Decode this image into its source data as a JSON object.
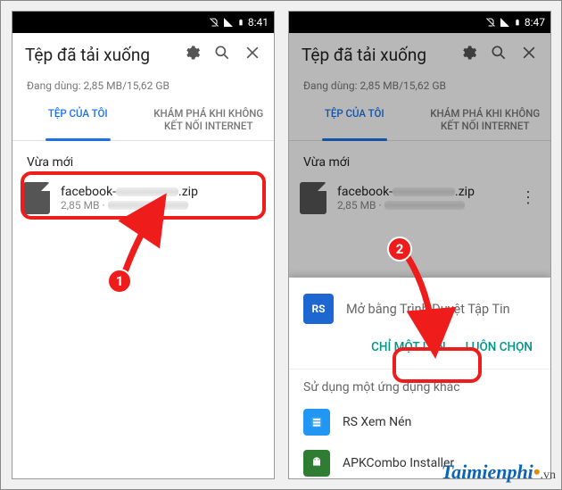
{
  "statusbar": {
    "time_left": "8:41",
    "time_right": "8:47"
  },
  "toolbar": {
    "title": "Tệp đã tải xuống"
  },
  "storage": {
    "line": "Đang dùng: 2,85 MB/15,62 GB"
  },
  "tabs": {
    "mine": "TỆP CỦA TÔI",
    "offline": "KHÁM PHÁ KHI KHÔNG KẾT NỐI INTERNET"
  },
  "section": {
    "recent": "Vừa mới"
  },
  "file": {
    "prefix": "facebook-",
    "suffix": ".zip",
    "size": "2,85 MB"
  },
  "sheet": {
    "open_with": "Mở bằng Trình Duyệt Tập Tin",
    "once": "CHỈ MỘT LẦN",
    "always": "LUÔN CHỌN",
    "other_apps": "Sử dụng một ứng dụng khác",
    "apps": {
      "rs": "RS Xem Nén",
      "apk": "APKCombo Installer"
    }
  },
  "badges": {
    "one": "1",
    "two": "2"
  },
  "watermark": {
    "brand": "Taimienphi",
    "tld": ".vn"
  }
}
